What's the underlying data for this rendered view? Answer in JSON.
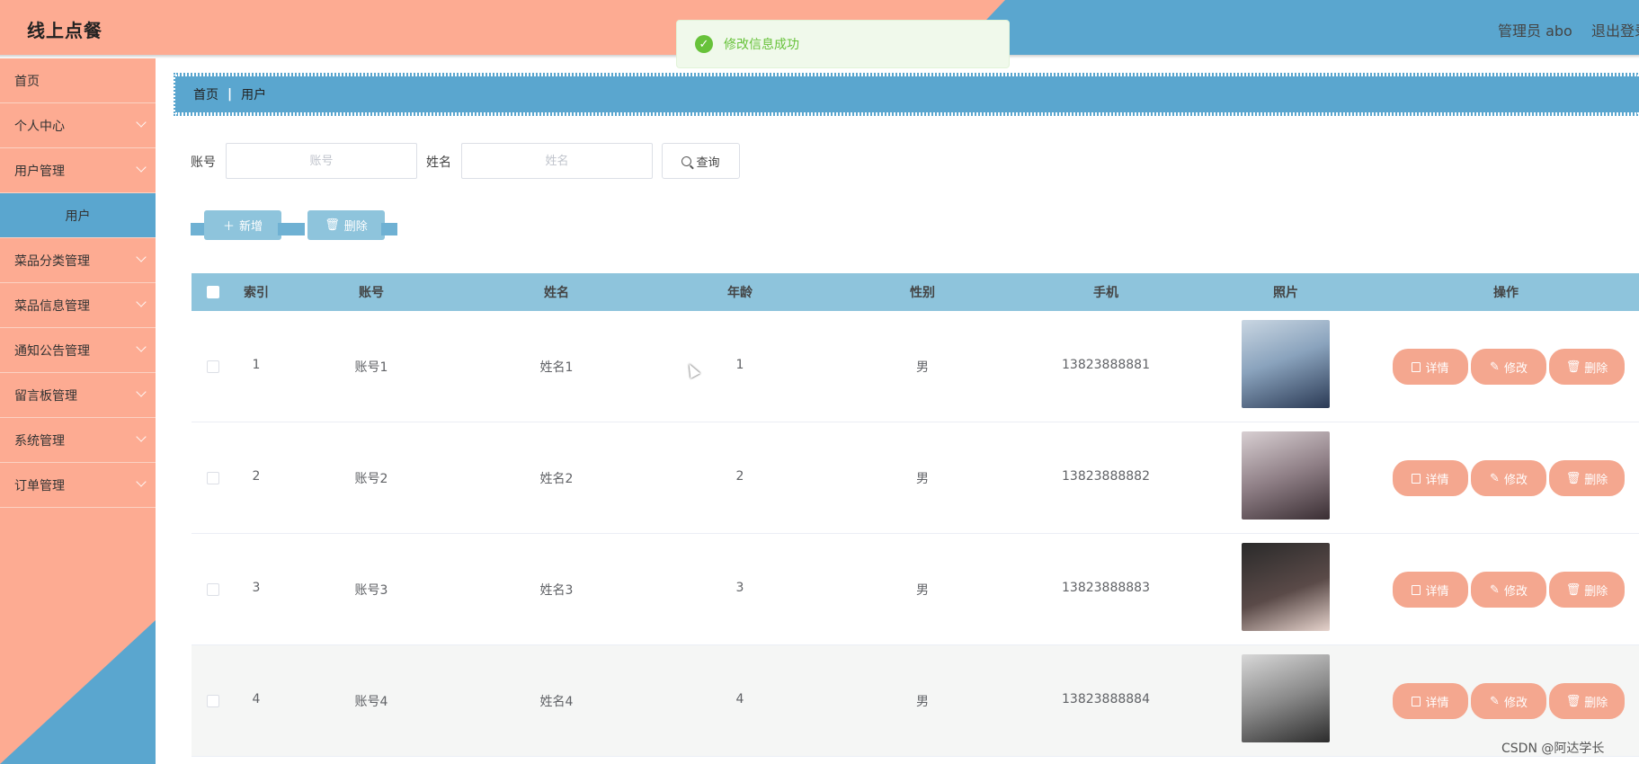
{
  "header": {
    "title": "线上点餐",
    "admin": "管理员 abo",
    "logout": "退出登录"
  },
  "toast": {
    "message": "修改信息成功"
  },
  "sidebar": {
    "items": [
      {
        "label": "首页",
        "expandable": false
      },
      {
        "label": "个人中心",
        "expandable": true
      },
      {
        "label": "用户管理",
        "expandable": true
      },
      {
        "label": "用户",
        "expandable": false,
        "active": true
      },
      {
        "label": "菜品分类管理",
        "expandable": true
      },
      {
        "label": "菜品信息管理",
        "expandable": true
      },
      {
        "label": "通知公告管理",
        "expandable": true
      },
      {
        "label": "留言板管理",
        "expandable": true
      },
      {
        "label": "系统管理",
        "expandable": true
      },
      {
        "label": "订单管理",
        "expandable": true
      }
    ]
  },
  "breadcrumb": {
    "home": "首页",
    "current": "用户"
  },
  "search": {
    "account_label": "账号",
    "account_placeholder": "账号",
    "name_label": "姓名",
    "name_placeholder": "姓名",
    "button": "查询"
  },
  "actions": {
    "add": "新增",
    "delete": "删除"
  },
  "table": {
    "headers": [
      "索引",
      "账号",
      "姓名",
      "年龄",
      "性别",
      "手机",
      "照片",
      "操作"
    ],
    "rows": [
      {
        "index": "1",
        "account": "账号1",
        "name": "姓名1",
        "age": "1",
        "gender": "男",
        "phone": "13823888881"
      },
      {
        "index": "2",
        "account": "账号2",
        "name": "姓名2",
        "age": "2",
        "gender": "男",
        "phone": "13823888882"
      },
      {
        "index": "3",
        "account": "账号3",
        "name": "姓名3",
        "age": "3",
        "gender": "男",
        "phone": "13823888883"
      },
      {
        "index": "4",
        "account": "账号4",
        "name": "姓名4",
        "age": "4",
        "gender": "男",
        "phone": "13823888884"
      }
    ],
    "row_ops": {
      "detail": "详情",
      "edit": "修改",
      "delete": "删除"
    }
  },
  "watermark": "CSDN @阿达学长",
  "colors": {
    "peach": "#fdab92",
    "blue": "#5aa6cf",
    "table_header": "#8ec4dc",
    "success": "#67c23a"
  }
}
